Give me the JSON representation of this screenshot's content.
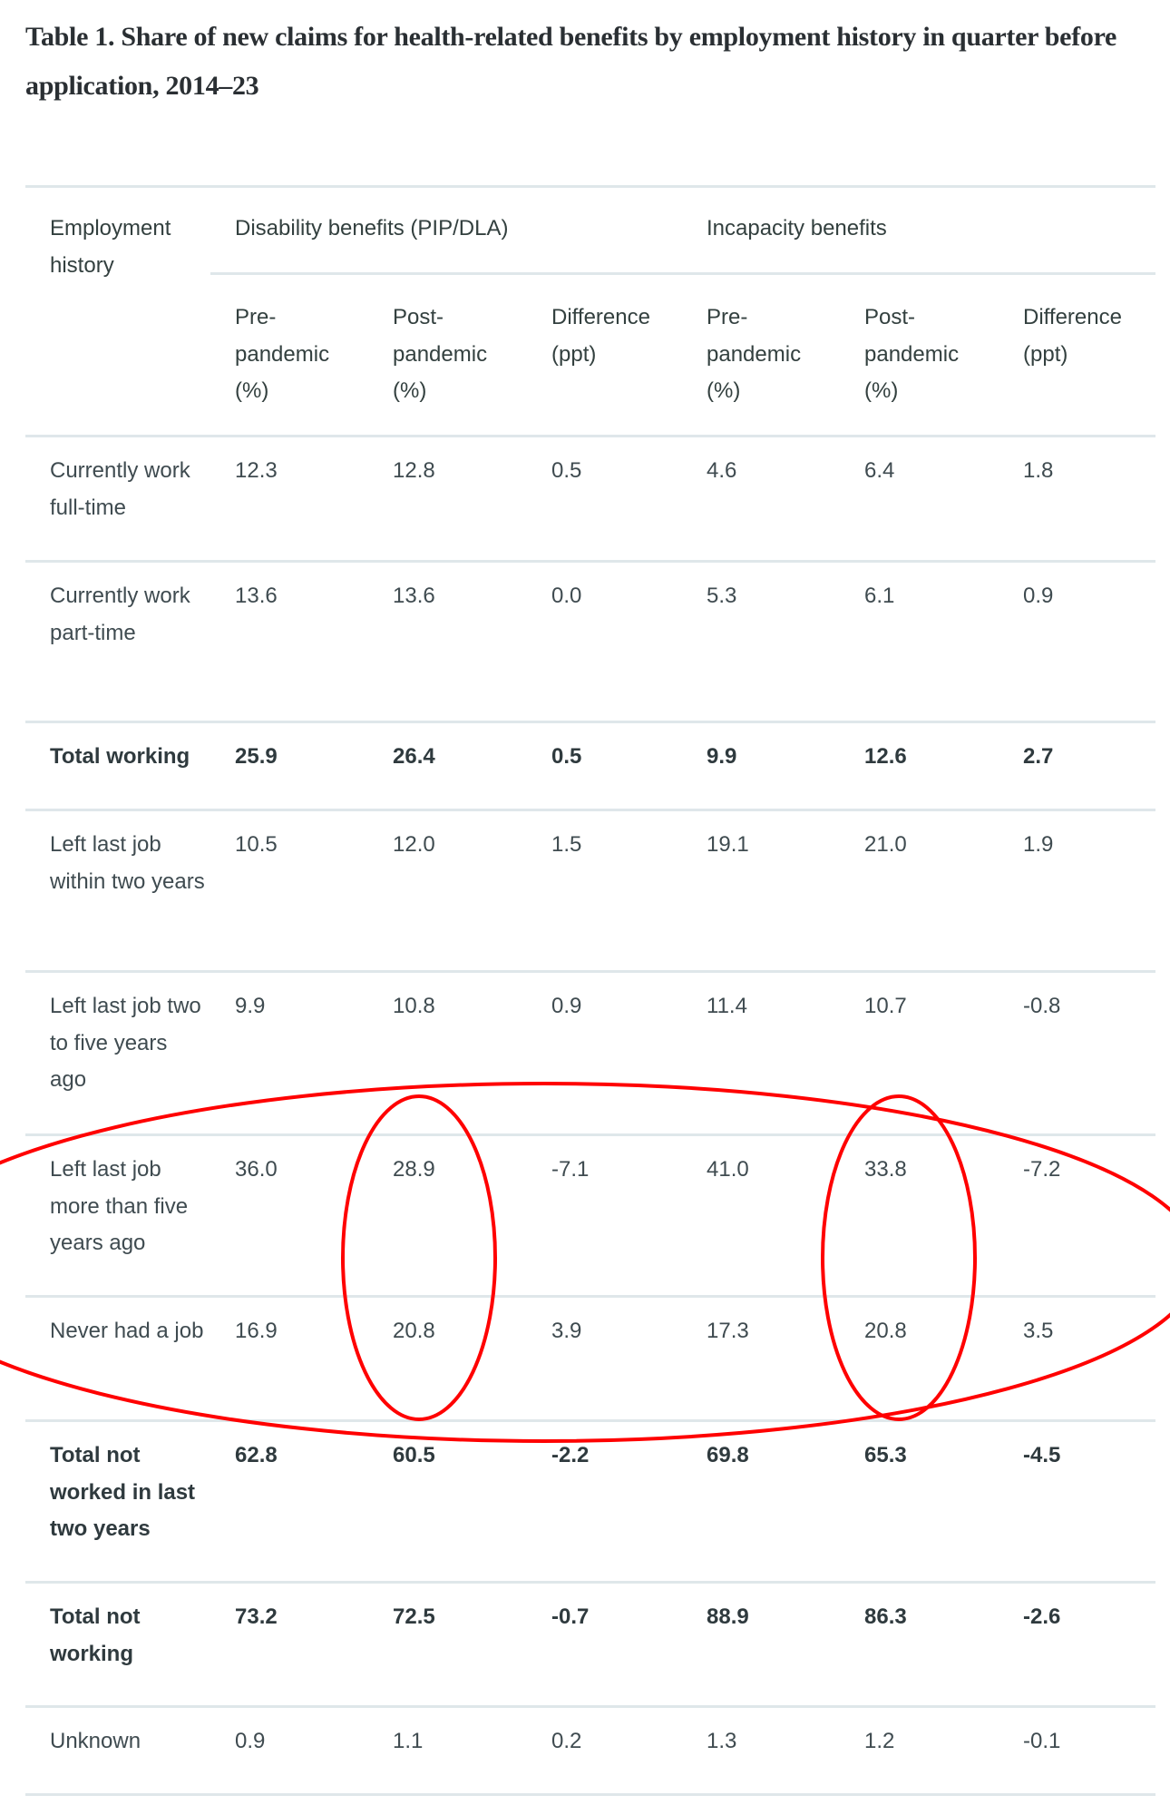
{
  "title": "Table 1. Share of new claims for health-related benefits by employment history in quarter before application, 2014–23",
  "table": {
    "header": {
      "row_label": "Employment history",
      "groups": [
        "Disability benefits (PIP/DLA)",
        "Incapacity benefits"
      ],
      "columns": [
        "Pre-pandemic (%)",
        "Post-pandemic (%)",
        "Difference (ppt)",
        "Pre-pandemic (%)",
        "Post-pandemic (%)",
        "Difference (ppt)"
      ]
    },
    "rows": [
      {
        "label": "Currently work full-time",
        "bold": false,
        "values": [
          "12.3",
          "12.8",
          "0.5",
          "4.6",
          "6.4",
          "1.8"
        ]
      },
      {
        "label": "Currently work part-time",
        "bold": false,
        "values": [
          "13.6",
          "13.6",
          "0.0",
          "5.3",
          "6.1",
          "0.9"
        ]
      },
      {
        "label": "Total working",
        "bold": true,
        "values": [
          "25.9",
          "26.4",
          "0.5",
          "9.9",
          "12.6",
          "2.7"
        ]
      },
      {
        "label": "Left last job within two years",
        "bold": false,
        "values": [
          "10.5",
          "12.0",
          "1.5",
          "19.1",
          "21.0",
          "1.9"
        ]
      },
      {
        "label": "Left last job two to five years ago",
        "bold": false,
        "values": [
          "9.9",
          "10.8",
          "0.9",
          "11.4",
          "10.7",
          "-0.8"
        ]
      },
      {
        "label": "Left last job more than five years ago",
        "bold": false,
        "values": [
          "36.0",
          "28.9",
          "-7.1",
          "41.0",
          "33.8",
          "-7.2"
        ]
      },
      {
        "label": "Never had a job",
        "bold": false,
        "values": [
          "16.9",
          "20.8",
          "3.9",
          "17.3",
          "20.8",
          "3.5"
        ]
      },
      {
        "label": "Total not worked in last two years",
        "bold": true,
        "values": [
          "62.8",
          "60.5",
          "-2.2",
          "69.8",
          "65.3",
          "-4.5"
        ]
      },
      {
        "label": "Total not working",
        "bold": true,
        "values": [
          "73.2",
          "72.5",
          "-0.7",
          "88.9",
          "86.3",
          "-2.6"
        ]
      },
      {
        "label": "Unknown",
        "bold": false,
        "values": [
          "0.9",
          "1.1",
          "0.2",
          "1.3",
          "1.2",
          "-0.1"
        ]
      }
    ]
  },
  "annotations": {
    "color": "#ff0000",
    "highlighted_rows": [
      "Left last job more than five years ago",
      "Never had a job"
    ],
    "highlighted_columns": [
      "Disability benefits Post-pandemic (%)",
      "Incapacity benefits Post-pandemic (%)"
    ]
  }
}
